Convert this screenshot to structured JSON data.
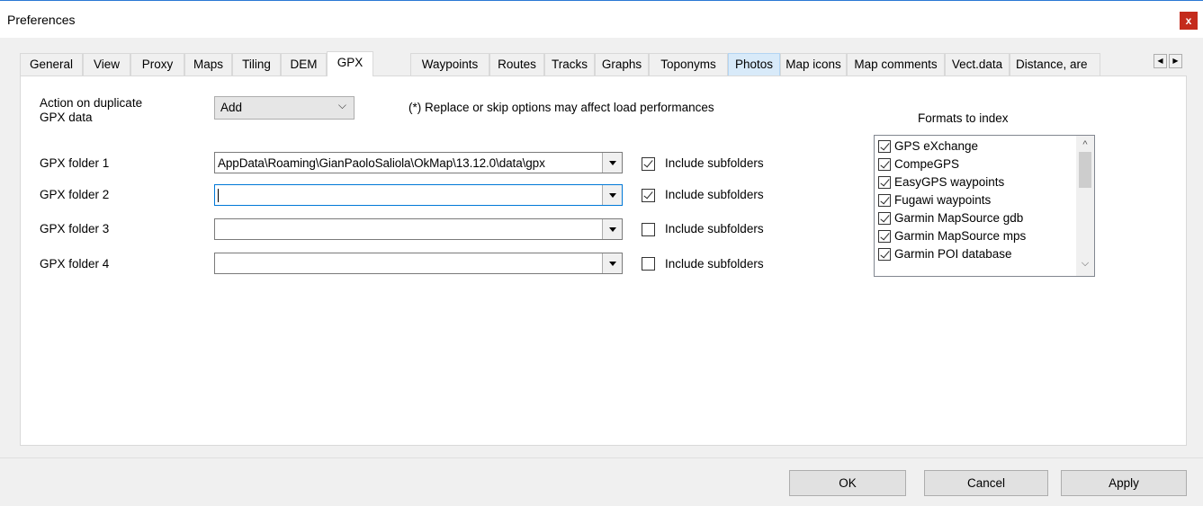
{
  "window": {
    "title": "Preferences",
    "close_label": "x"
  },
  "tabs": [
    {
      "label": "General"
    },
    {
      "label": "View"
    },
    {
      "label": "Proxy"
    },
    {
      "label": "Maps"
    },
    {
      "label": "Tiling"
    },
    {
      "label": "DEM"
    },
    {
      "label": "GPX"
    },
    {
      "label": "Waypoints"
    },
    {
      "label": "Routes"
    },
    {
      "label": "Tracks"
    },
    {
      "label": "Graphs"
    },
    {
      "label": "Toponyms"
    },
    {
      "label": "Photos"
    },
    {
      "label": "Map icons"
    },
    {
      "label": "Map comments"
    },
    {
      "label": "Vect.data"
    },
    {
      "label": "Distance, are"
    }
  ],
  "active_tab": "GPX",
  "tab_scroll": {
    "left": "◀",
    "right": "▶"
  },
  "gpx": {
    "duplicate_label_line1": "Action on duplicate",
    "duplicate_label_line2": "GPX data",
    "duplicate_value": "Add",
    "duplicate_chevron": "⌵",
    "note": "(*) Replace or skip options may affect load performances",
    "folders": [
      {
        "label": "GPX folder 1",
        "value": "AppData\\Roaming\\GianPaoloSaliola\\OkMap\\13.12.0\\data\\gpx",
        "include_label": "Include subfolders",
        "include_checked": true
      },
      {
        "label": "GPX folder 2",
        "value": "",
        "include_label": "Include subfolders",
        "include_checked": true
      },
      {
        "label": "GPX folder 3",
        "value": "",
        "include_label": "Include subfolders",
        "include_checked": false
      },
      {
        "label": "GPX folder 4",
        "value": "",
        "include_label": "Include subfolders",
        "include_checked": false
      }
    ],
    "formats_title": "Formats to index",
    "formats": [
      {
        "name": "GPS eXchange",
        "checked": true
      },
      {
        "name": "CompeGPS",
        "checked": true
      },
      {
        "name": "EasyGPS waypoints",
        "checked": true
      },
      {
        "name": "Fugawi waypoints",
        "checked": true
      },
      {
        "name": "Garmin MapSource gdb",
        "checked": true
      },
      {
        "name": "Garmin MapSource mps",
        "checked": true
      },
      {
        "name": "Garmin POI database",
        "checked": true
      }
    ],
    "scroll_up": "^",
    "scroll_down": "⌵"
  },
  "buttons": {
    "ok": "OK",
    "cancel": "Cancel",
    "apply": "Apply"
  },
  "colors": {
    "accent": "#0078d7",
    "close": "#c42b1c",
    "hover_tab": "#d8eaf9"
  }
}
